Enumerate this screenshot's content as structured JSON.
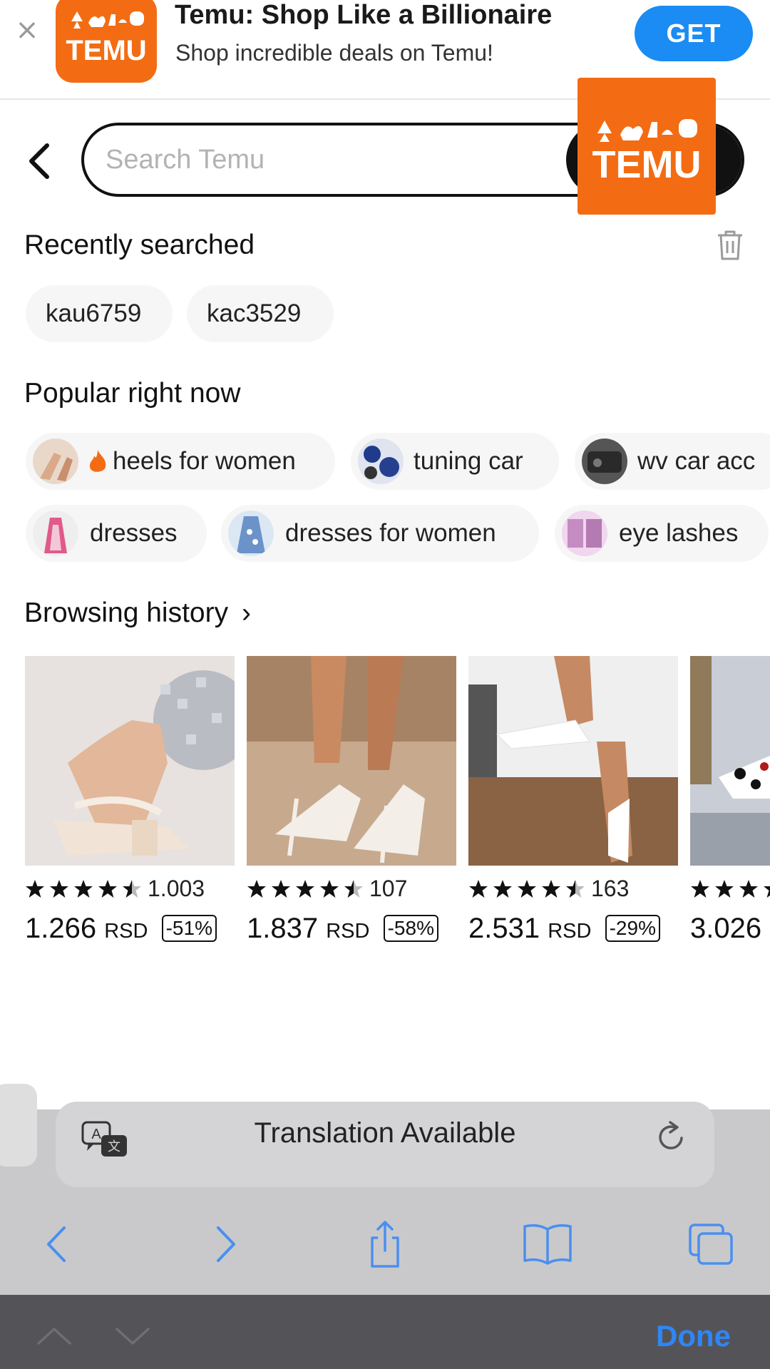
{
  "banner": {
    "close_symbol": "×",
    "title": "Temu: Shop Like a Billionaire",
    "subtitle": "Shop incredible deals on Temu!",
    "get_label": "GET",
    "logo_text": "TEMU"
  },
  "search": {
    "placeholder": "Search Temu",
    "overlay_logo_text": "TEMU"
  },
  "recently_searched": {
    "title": "Recently searched",
    "chips": [
      "kau6759",
      "kac3529"
    ]
  },
  "popular": {
    "title": "Popular right now",
    "chips": [
      "heels for women",
      "tuning car",
      "wv car acc",
      "dresses",
      "dresses for women",
      "eye lashes"
    ]
  },
  "browsing_history": {
    "title": "Browsing history",
    "chevron": "›",
    "products": [
      {
        "rating_count": "1.003",
        "stars": 4.5,
        "price": "1.266",
        "currency": "RSD",
        "discount": "-51%"
      },
      {
        "rating_count": "107",
        "stars": 4.5,
        "price": "1.837",
        "currency": "RSD",
        "discount": "-58%"
      },
      {
        "rating_count": "163",
        "stars": 4.5,
        "price": "2.531",
        "currency": "RSD",
        "discount": "-29%"
      },
      {
        "rating_count": "",
        "stars": 3,
        "price": "3.026",
        "currency": "",
        "discount": ""
      }
    ]
  },
  "translation": {
    "label": "Translation Available"
  },
  "keyboard_bar": {
    "done_label": "Done"
  },
  "colors": {
    "temu_orange": "#f36c13",
    "ios_blue": "#2f86f6",
    "get_blue": "#1a8cf3"
  }
}
